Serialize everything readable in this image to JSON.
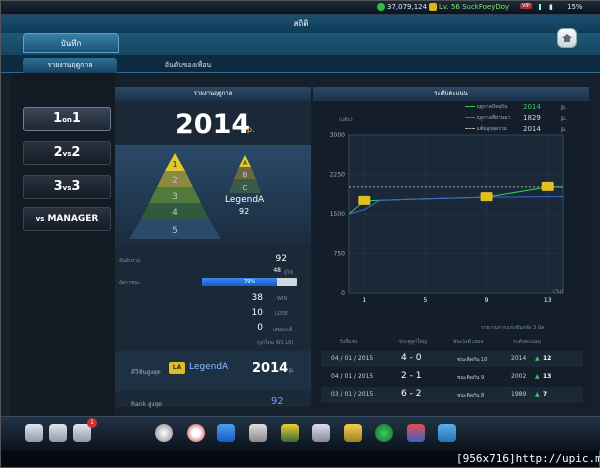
{
  "status": {
    "money": "37,079,124",
    "level": "Lv. 56 SuckFoeyDoy",
    "vip": "VIP",
    "battery": "15%"
  },
  "title": "สถิติ",
  "tabs": {
    "main": "บันทึก"
  },
  "subtabs": {
    "record": "รายงานฤดูกาล",
    "friends": "อันดับของเพื่อน"
  },
  "modes": [
    "1on1",
    "2vs2",
    "3vs3",
    "vs MANAGER"
  ],
  "season": {
    "header": "รายงานฤดูกาล",
    "year": "2014",
    "year_unit": "p.",
    "tier_name": "LegendA",
    "tier_points": "92",
    "pyramid_levels": [
      "1",
      "2",
      "3",
      "4",
      "5"
    ],
    "small_pyramid_levels": [
      "A",
      "B",
      "C"
    ]
  },
  "stats": {
    "rank_label": "อันดับรวม",
    "rank_value": "92",
    "rank_sub": "48",
    "rank_sub_unit": "ผู้ใช้",
    "winrate_label": "อัตราชนะ",
    "winrate_text": "79%",
    "winrate_value": 79,
    "win": "38",
    "win_label": "WIN",
    "lose": "10",
    "lose_label": "LOSE",
    "draw": "0",
    "draw_label": "เสมอ/แพ้",
    "note": "(ถูกไทม W1 L0)"
  },
  "best": {
    "label": "ดีวีชั่นสูงสุด",
    "badge": "LA",
    "tier": "LegendA",
    "points": "2014",
    "points_unit": "p.",
    "rank_label": "Rank สูงสุด",
    "rank_value": "92"
  },
  "chart": {
    "header": "ระดับคะแนน",
    "yunit": "(แต้ม)",
    "xunit": "(วัน)",
    "legend": [
      {
        "label": "ฤดูกาลปัจจุบัน",
        "value": "2014",
        "unit": "p.",
        "color": "#3ac95a"
      },
      {
        "label": "ฤดูกาลที่ผ่านมา",
        "value": "1829",
        "unit": "p.",
        "color": "#3a6ad8"
      },
      {
        "label": "แต้มสูงสุดรวม",
        "value": "2014",
        "unit": "p.",
        "color": "#aaaaaa"
      }
    ]
  },
  "chart_data": {
    "type": "line",
    "xlabel": "(วัน)",
    "ylabel": "(แต้ม)",
    "xticks": [
      1,
      5,
      9,
      13
    ],
    "yticks": [
      0,
      750,
      1500,
      2250,
      3000
    ],
    "xlim": [
      0,
      14
    ],
    "ylim": [
      0,
      3000
    ],
    "series": [
      {
        "name": "ฤดูกาลปัจจุบัน",
        "color": "#3ac95a",
        "x": [
          0,
          1,
          2,
          5,
          9,
          13,
          14
        ],
        "y": [
          1500,
          1750,
          1760,
          1790,
          1820,
          2014,
          2014
        ]
      },
      {
        "name": "ฤดูกาลที่ผ่านมา",
        "color": "#3a6ad8",
        "x": [
          0,
          1,
          2,
          5,
          9,
          13,
          14
        ],
        "y": [
          1500,
          1580,
          1760,
          1790,
          1820,
          1830,
          1829
        ]
      },
      {
        "name": "แต้มสูงสุดรวม",
        "color": "#aaaaaa",
        "x": [
          0,
          14
        ],
        "y": [
          2014,
          2014
        ]
      }
    ],
    "grid": true
  },
  "history": {
    "title": "รายงานการแข่งขันหลัง 3 นัด",
    "headers": [
      "วันที่แข่ง",
      "ประตูลูกใหญ่",
      "ชนะ/แพ้ เสมอ",
      "ระดับคะแนน"
    ],
    "rows": [
      {
        "date": "04 / 01 / 2015",
        "score": "4 - 0",
        "result": "ชนะติดกัน 10",
        "points": "2014",
        "delta": "12"
      },
      {
        "date": "04 / 01 / 2015",
        "score": "2 - 1",
        "result": "ชนะติดกัน 9",
        "points": "2002",
        "delta": "13"
      },
      {
        "date": "03 / 01 / 2015",
        "score": "6 - 2",
        "result": "ชนะติดกัน 8",
        "points": "1989",
        "delta": "7"
      }
    ]
  },
  "dock_badge": "1",
  "footer": "[956x716]http://upic.me/"
}
